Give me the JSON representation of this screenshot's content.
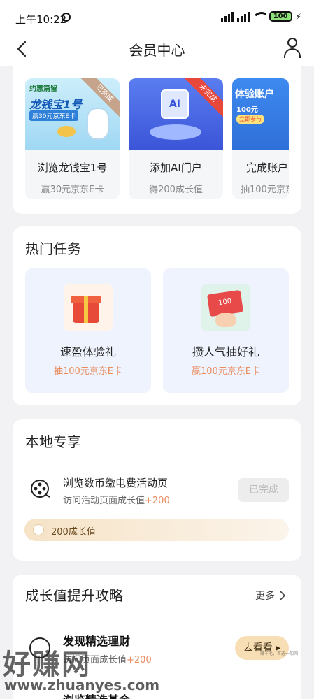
{
  "status_bar": {
    "time": "上午10:22",
    "battery": "100"
  },
  "header": {
    "title": "会员中心",
    "back_icon": "chevron-left-icon",
    "user_icon": "user-icon"
  },
  "top_cards": [
    {
      "name": "浏览龙钱宝1号",
      "sub": "赢30元京东E卡",
      "badge": "已完成",
      "art_title": "龙钱宝1号",
      "art_sub": "赢30元京东E卡",
      "art_tag": "约惠篇留"
    },
    {
      "name": "添加AI门户",
      "sub": "得200成长值",
      "badge": "未完成",
      "art_title": "AI"
    },
    {
      "name": "完成账户",
      "sub": "抽100元京东",
      "art_title": "体验账户",
      "art_sub": "100元",
      "art_tag": "立即参与"
    }
  ],
  "hot": {
    "title": "热门任务",
    "items": [
      {
        "name": "速盈体验礼",
        "sub": "抽100元京东E卡"
      },
      {
        "name": "攒人气抽好礼",
        "sub": "赢100元京东E卡",
        "art": "100"
      }
    ]
  },
  "local": {
    "title": "本地专享",
    "item_title": "浏览数币缴电费活动页",
    "item_desc": "访问活动页面成长值",
    "item_bonus": "+200",
    "button": "已完成",
    "reward": "200成长值"
  },
  "growth": {
    "title": "成长值提升攻略",
    "more": "更多",
    "item_title": "发现精选理财",
    "item_desc": "访问页面成长值",
    "item_bonus": "+200",
    "button": "去看看",
    "next_item": "浏览精选基金"
  },
  "watermark": {
    "brand": "好赚网",
    "url": "www.zhuanyes.com",
    "note": "赚羊毛，首选一加网"
  },
  "colors": {
    "accent_orange": "#ea8a5d",
    "gold": "#f8deb4",
    "bg": "#f2f2f4"
  }
}
